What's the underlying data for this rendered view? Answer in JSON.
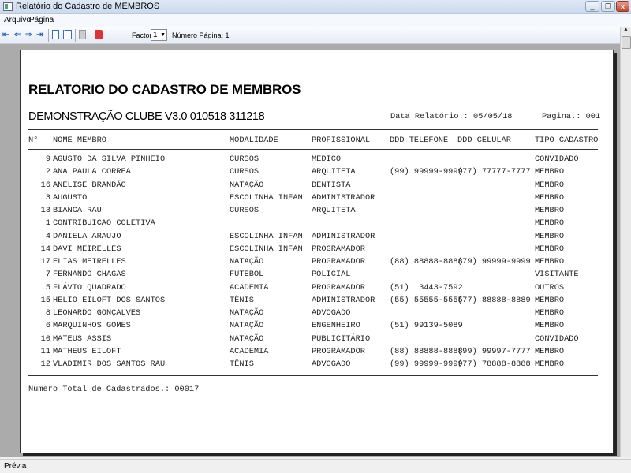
{
  "window": {
    "title": "Relatório do Cadastro de MEMBROS"
  },
  "menu": [
    "Arquivo",
    "Página"
  ],
  "toolbar": {
    "factor_label": "Factor:",
    "factor_value": "1",
    "page_label": "Número Página: 1"
  },
  "report": {
    "title": "RELATORIO DO CADASTRO DE MEMBROS",
    "subtitle": "DEMONSTRAÇÃO CLUBE V3.0 010518 311218",
    "date": "Data Relatório.: 05/05/18",
    "page": "Pagina.: 001",
    "columns": [
      "N°",
      "NOME MEMBRO",
      "MODALIDADE",
      "PROFISSIONAL",
      "DDD TELEFONE",
      "DDD CELULAR",
      "TIPO CADASTRO"
    ],
    "rows": [
      [
        "9",
        "AGUSTO DA SILVA PINHEIO",
        "CURSOS",
        "MEDICO",
        "",
        "",
        "CONVIDADO"
      ],
      [
        "2",
        "ANA PAULA CORREA",
        "CURSOS",
        "ARQUITETA",
        "(99) 99999-9999",
        "(77) 77777-7777",
        "MEMBRO"
      ],
      [
        "16",
        "ANELISE BRANDÃO",
        "NATAÇÃO",
        "DENTISTA",
        "",
        "",
        "MEMBRO"
      ],
      [
        "3",
        "AUGUSTO",
        "ESCOLINHA INFAN",
        "ADMINISTRADOR",
        "",
        "",
        "MEMBRO"
      ],
      [
        "13",
        "BIANCA RAU",
        "CURSOS",
        "ARQUITETA",
        "",
        "",
        "MEMBRO"
      ],
      [
        "1",
        "CONTRIBUICAO COLETIVA",
        "",
        "",
        "",
        "",
        "MEMBRO"
      ],
      [
        "4",
        "DANIELA ARAUJO",
        "ESCOLINHA INFAN",
        "ADMINISTRADOR",
        "",
        "",
        "MEMBRO"
      ],
      [
        "14",
        "DAVI MEIRELLES",
        "ESCOLINHA INFAN",
        "PROGRAMADOR",
        "",
        "",
        "MEMBRO"
      ],
      [
        "17",
        "ELIAS MEIRELLES",
        "NATAÇÃO",
        "PROGRAMADOR",
        "(88) 88888-8888",
        "(79) 99999-9999",
        "MEMBRO"
      ],
      [
        "7",
        "FERNANDO CHAGAS",
        "FUTEBOL",
        "POLICIAL",
        "",
        "",
        "VISITANTE"
      ],
      [
        "5",
        "FLÁVIO QUADRADO",
        "ACADEMIA",
        "PROGRAMADOR",
        "(51)  3443-7592",
        "",
        "OUTROS"
      ],
      [
        "15",
        "HELIO EILOFT DOS SANTOS",
        "TÊNIS",
        "ADMINISTRADOR",
        "(55) 55555-5555",
        "(77) 88888-8889",
        "MEMBRO"
      ],
      [
        "8",
        "LEONARDO GONÇALVES",
        "NATAÇÃO",
        "ADVOGADO",
        "",
        "",
        "MEMBRO"
      ],
      [
        "6",
        "MARQUINHOS GOMES",
        "NATAÇÃO",
        "ENGENHEIRO",
        "(51) 99139-5089",
        "",
        "MEMBRO"
      ],
      [
        "10",
        "MATEUS ASSIS",
        "NATAÇÃO",
        "PUBLICITÁRIO",
        "",
        "",
        "CONVIDADO"
      ],
      [
        "11",
        "MATHEUS EILOFT",
        "ACADEMIA",
        "PROGRAMADOR",
        "(88) 88888-8888",
        "(99) 99997-7777",
        "MEMBRO"
      ],
      [
        "12",
        "VLADIMIR DOS SANTOS RAU",
        "TÊNIS",
        "ADVOGADO",
        "(99) 99999-9999",
        "(77) 78888-8888",
        "MEMBRO"
      ]
    ],
    "total": "Numero Total de Cadastrados.: 00017"
  },
  "status": "Prévia"
}
